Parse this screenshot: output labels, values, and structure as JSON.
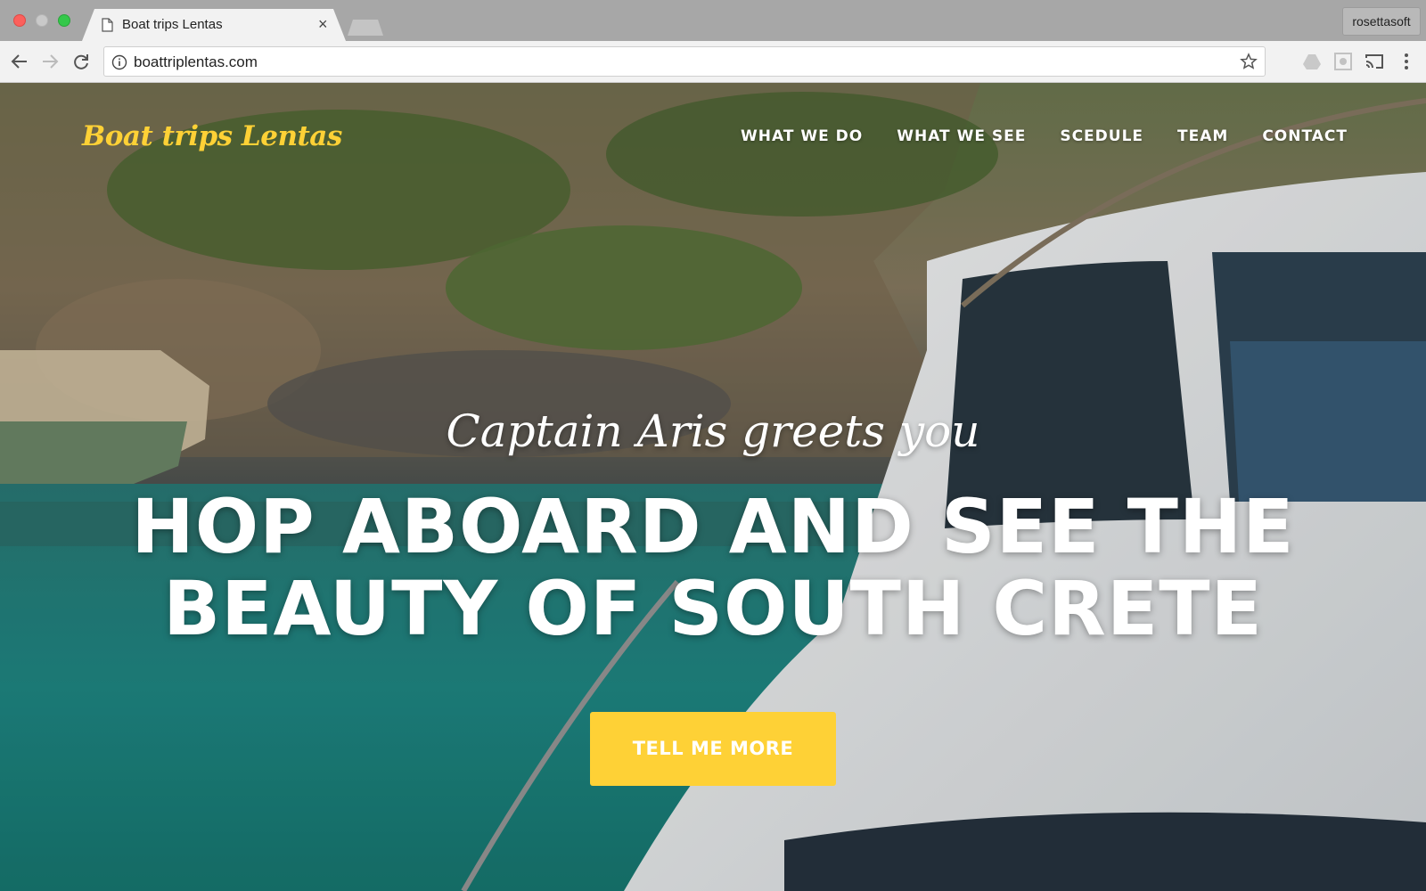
{
  "browser": {
    "tab_title": "Boat trips Lentas",
    "tab_close": "×",
    "url": "boattriplentas.com",
    "profile_name": "rosettasoft"
  },
  "site": {
    "brand": "Boat trips Lentas",
    "nav": [
      {
        "label": "WHAT WE DO"
      },
      {
        "label": "WHAT WE SEE"
      },
      {
        "label": "SCEDULE"
      },
      {
        "label": "TEAM"
      },
      {
        "label": "CONTACT"
      }
    ],
    "hero": {
      "lead": "Captain Aris greets you",
      "headline": "HOP ABOARD AND SEE THE BEAUTY OF SOUTH CRETE",
      "cta": "TELL ME MORE"
    }
  },
  "colors": {
    "accent": "#fed136",
    "sea": "#1f8a86",
    "boat_white": "#f3f5f6"
  },
  "icons": [
    "back-icon",
    "forward-icon",
    "reload-icon",
    "info-icon",
    "star-icon",
    "drive-icon",
    "extension-icon",
    "cast-icon",
    "menu-icon",
    "document-icon"
  ]
}
